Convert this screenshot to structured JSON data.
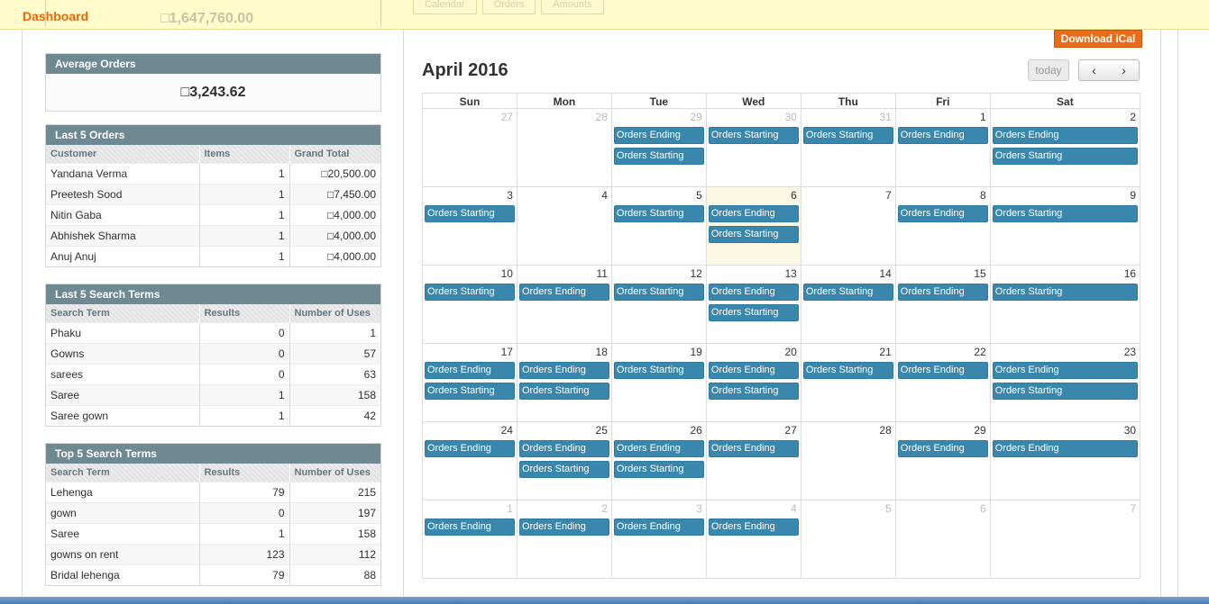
{
  "header": {
    "title": "Dashboard",
    "lifetime_sales_value": "1,647,760.00",
    "tabs": [
      "Calendar",
      "Orders",
      "Amounts"
    ]
  },
  "average_orders": {
    "title": "Average Orders",
    "value": "3,243.62"
  },
  "last_orders": {
    "title": "Last 5 Orders",
    "columns": [
      "Customer",
      "Items",
      "Grand Total"
    ],
    "rows": [
      [
        "Yandana Verma",
        "1",
        "20,500.00"
      ],
      [
        "Preetesh Sood",
        "1",
        "7,450.00"
      ],
      [
        "Nitin Gaba",
        "1",
        "4,000.00"
      ],
      [
        "Abhishek Sharma",
        "1",
        "4,000.00"
      ],
      [
        "Anuj Anuj",
        "1",
        "4,000.00"
      ]
    ]
  },
  "last_search": {
    "title": "Last 5 Search Terms",
    "columns": [
      "Search Term",
      "Results",
      "Number of Uses"
    ],
    "rows": [
      [
        "Phaku",
        "0",
        "1"
      ],
      [
        "Gowns",
        "0",
        "57"
      ],
      [
        "sarees",
        "0",
        "63"
      ],
      [
        "Saree",
        "1",
        "158"
      ],
      [
        "Saree gown",
        "1",
        "42"
      ]
    ]
  },
  "top_search": {
    "title": "Top 5 Search Terms",
    "columns": [
      "Search Term",
      "Results",
      "Number of Uses"
    ],
    "rows": [
      [
        "Lehenga",
        "79",
        "215"
      ],
      [
        "gown",
        "0",
        "197"
      ],
      [
        "Saree",
        "1",
        "158"
      ],
      [
        "gowns on rent",
        "123",
        "112"
      ],
      [
        "Bridal lehenga",
        "79",
        "88"
      ]
    ]
  },
  "calendar": {
    "download_label": "Download iCal",
    "title": "April 2016",
    "today_label": "today",
    "prev_label": "‹",
    "next_label": "›",
    "weekdays": [
      "Sun",
      "Mon",
      "Tue",
      "Wed",
      "Thu",
      "Fri",
      "Sat"
    ],
    "weeks": [
      [
        {
          "day": "27",
          "other": true,
          "events": []
        },
        {
          "day": "28",
          "other": true,
          "events": []
        },
        {
          "day": "29",
          "other": true,
          "events": [
            "Orders Ending",
            "Orders Starting"
          ]
        },
        {
          "day": "30",
          "other": true,
          "events": [
            "Orders Starting"
          ]
        },
        {
          "day": "31",
          "other": true,
          "events": [
            "Orders Starting"
          ]
        },
        {
          "day": "1",
          "events": [
            "Orders Ending"
          ]
        },
        {
          "day": "2",
          "events": [
            "Orders Ending",
            "Orders Starting"
          ]
        }
      ],
      [
        {
          "day": "3",
          "events": [
            "Orders Starting"
          ]
        },
        {
          "day": "4",
          "events": []
        },
        {
          "day": "5",
          "events": [
            "Orders Starting"
          ]
        },
        {
          "day": "6",
          "today": true,
          "events": [
            "Orders Ending",
            "Orders Starting"
          ]
        },
        {
          "day": "7",
          "events": []
        },
        {
          "day": "8",
          "events": [
            "Orders Ending"
          ]
        },
        {
          "day": "9",
          "events": [
            "Orders Starting"
          ]
        }
      ],
      [
        {
          "day": "10",
          "events": [
            "Orders Starting"
          ]
        },
        {
          "day": "11",
          "events": [
            "Orders Ending"
          ]
        },
        {
          "day": "12",
          "events": [
            "Orders Starting"
          ]
        },
        {
          "day": "13",
          "events": [
            "Orders Ending",
            "Orders Starting"
          ]
        },
        {
          "day": "14",
          "events": [
            "Orders Starting"
          ]
        },
        {
          "day": "15",
          "events": [
            "Orders Ending"
          ]
        },
        {
          "day": "16",
          "events": [
            "Orders Starting"
          ]
        }
      ],
      [
        {
          "day": "17",
          "events": [
            "Orders Ending",
            "Orders Starting"
          ]
        },
        {
          "day": "18",
          "events": [
            "Orders Ending",
            "Orders Starting"
          ]
        },
        {
          "day": "19",
          "events": [
            "Orders Starting"
          ]
        },
        {
          "day": "20",
          "events": [
            "Orders Ending",
            "Orders Starting"
          ]
        },
        {
          "day": "21",
          "events": [
            "Orders Starting"
          ]
        },
        {
          "day": "22",
          "events": [
            "Orders Ending"
          ]
        },
        {
          "day": "23",
          "events": [
            "Orders Ending",
            "Orders Starting"
          ]
        }
      ],
      [
        {
          "day": "24",
          "events": [
            "Orders Ending"
          ]
        },
        {
          "day": "25",
          "events": [
            "Orders Ending",
            "Orders Starting"
          ]
        },
        {
          "day": "26",
          "events": [
            "Orders Ending",
            "Orders Starting"
          ]
        },
        {
          "day": "27",
          "events": [
            "Orders Ending"
          ]
        },
        {
          "day": "28",
          "events": []
        },
        {
          "day": "29",
          "events": [
            "Orders Ending"
          ]
        },
        {
          "day": "30",
          "events": [
            "Orders Ending"
          ]
        }
      ],
      [
        {
          "day": "1",
          "other": true,
          "events": [
            "Orders Ending"
          ]
        },
        {
          "day": "2",
          "other": true,
          "events": [
            "Orders Ending"
          ]
        },
        {
          "day": "3",
          "other": true,
          "events": [
            "Orders Ending"
          ]
        },
        {
          "day": "4",
          "other": true,
          "events": [
            "Orders Ending"
          ]
        },
        {
          "day": "5",
          "other": true,
          "events": []
        },
        {
          "day": "6",
          "other": true,
          "events": []
        },
        {
          "day": "7",
          "other": true,
          "events": []
        }
      ]
    ]
  }
}
